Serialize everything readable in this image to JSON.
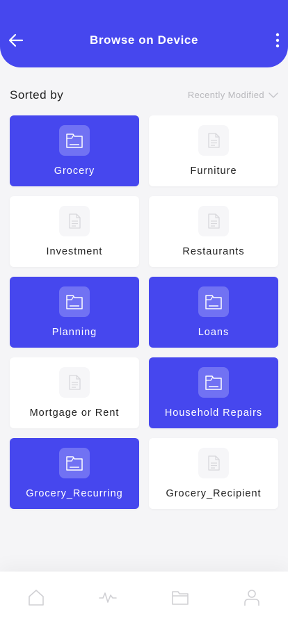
{
  "header": {
    "title": "Browse on Device"
  },
  "sort": {
    "label": "Sorted by",
    "selected": "Recently Modified"
  },
  "folders": [
    {
      "label": "Grocery",
      "active": true
    },
    {
      "label": "Furniture",
      "active": false
    },
    {
      "label": "Investment",
      "active": false
    },
    {
      "label": "Restaurants",
      "active": false
    },
    {
      "label": "Planning",
      "active": true
    },
    {
      "label": "Loans",
      "active": true
    },
    {
      "label": "Mortgage or Rent",
      "active": false
    },
    {
      "label": "Household Repairs",
      "active": true
    },
    {
      "label": "Grocery_Recurring",
      "active": true
    },
    {
      "label": "Grocery_Recipient",
      "active": false
    }
  ],
  "nav": [
    {
      "icon": "home-icon"
    },
    {
      "icon": "activity-icon"
    },
    {
      "icon": "folder-icon"
    },
    {
      "icon": "profile-icon"
    }
  ],
  "colors": {
    "accent": "#4647ee",
    "accent_light": "#7172f3",
    "background": "#f5f5f7"
  }
}
